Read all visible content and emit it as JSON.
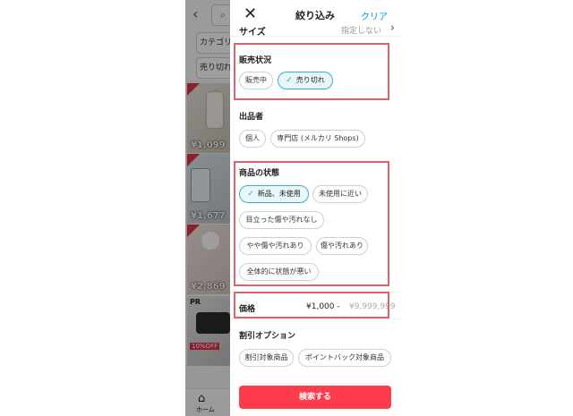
{
  "background_list": {
    "back_icon": "chevron-left-icon",
    "search_icon": "search-icon",
    "chips": [
      "カテゴリー",
      "売り切れ"
    ],
    "items": [
      {
        "price": "¥1,099",
        "sold": true
      },
      {
        "price": "¥1,677",
        "sold": true
      },
      {
        "price": "¥2,869",
        "sold": true
      },
      {
        "price": "",
        "sold": false,
        "badge": "PR",
        "tag": "10%OFF"
      }
    ],
    "nav_home_label": "ホーム",
    "nav_home_icon": "home-icon"
  },
  "header": {
    "close_icon": "close-icon",
    "title": "絞り込み",
    "clear_label": "クリア"
  },
  "size": {
    "label": "サイズ",
    "value": "指定しない",
    "arrow_icon": "chevron-right-icon"
  },
  "sale_status": {
    "title": "販売状況",
    "options": [
      {
        "label": "販売中",
        "selected": false
      },
      {
        "label": "売り切れ",
        "selected": true
      }
    ]
  },
  "seller": {
    "title": "出品者",
    "options": [
      {
        "label": "個人",
        "selected": false
      },
      {
        "label": "専門店 (メルカリ Shops)",
        "selected": false
      }
    ]
  },
  "condition": {
    "title": "商品の状態",
    "options": [
      {
        "label": "新品、未使用",
        "selected": true
      },
      {
        "label": "未使用に近い",
        "selected": false
      },
      {
        "label": "目立った傷や汚れなし",
        "selected": false
      },
      {
        "label": "やや傷や汚れあり",
        "selected": false
      },
      {
        "label": "傷や汚れあり",
        "selected": false
      },
      {
        "label": "全体的に状態が悪い",
        "selected": false
      }
    ]
  },
  "price": {
    "label": "価格",
    "min": "¥1,000 -",
    "max": "¥9,999,999"
  },
  "discount": {
    "title": "割引オプション",
    "options": [
      {
        "label": "割引対象商品",
        "selected": false
      },
      {
        "label": "ポイントバック対象商品",
        "selected": false
      }
    ]
  },
  "search_button": "検索する",
  "check_icon": "check-icon",
  "colors": {
    "accent": "#ff3b4e",
    "selected_border": "#3ab0c7",
    "link": "#0095ee",
    "highlight": "#e0606e"
  }
}
